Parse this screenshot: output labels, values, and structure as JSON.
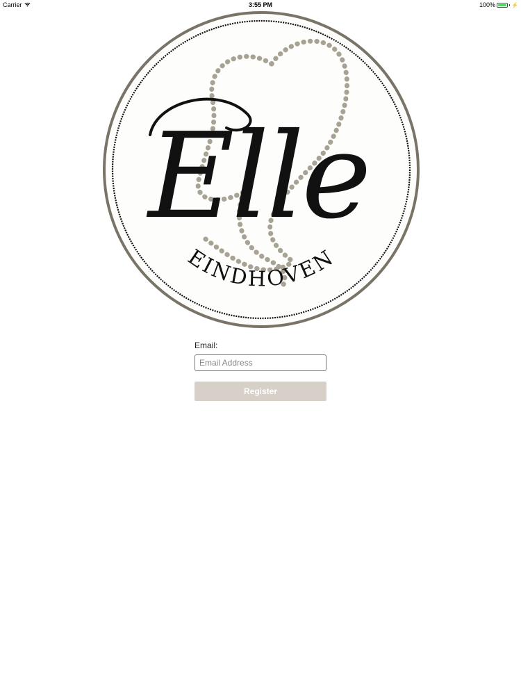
{
  "status_bar": {
    "carrier": "Carrier",
    "time": "3:55 PM",
    "battery": "100%",
    "battery_level": 1.0,
    "icons": [
      "wifi-icon",
      "battery-icon",
      "charging-bolt-icon"
    ]
  },
  "logo": {
    "script_text": "Elle",
    "subtitle_text": "EINDHOVEN",
    "colors": {
      "ring": "#7a7468",
      "dots": "#a8a294",
      "ink": "#111111"
    }
  },
  "form": {
    "email_label": "Email:",
    "email_placeholder": "Email Address",
    "email_value": "",
    "register_label": "Register"
  },
  "colors": {
    "button_bg": "#d6d0c8",
    "button_text": "#ffffff",
    "input_border": "#777777"
  }
}
